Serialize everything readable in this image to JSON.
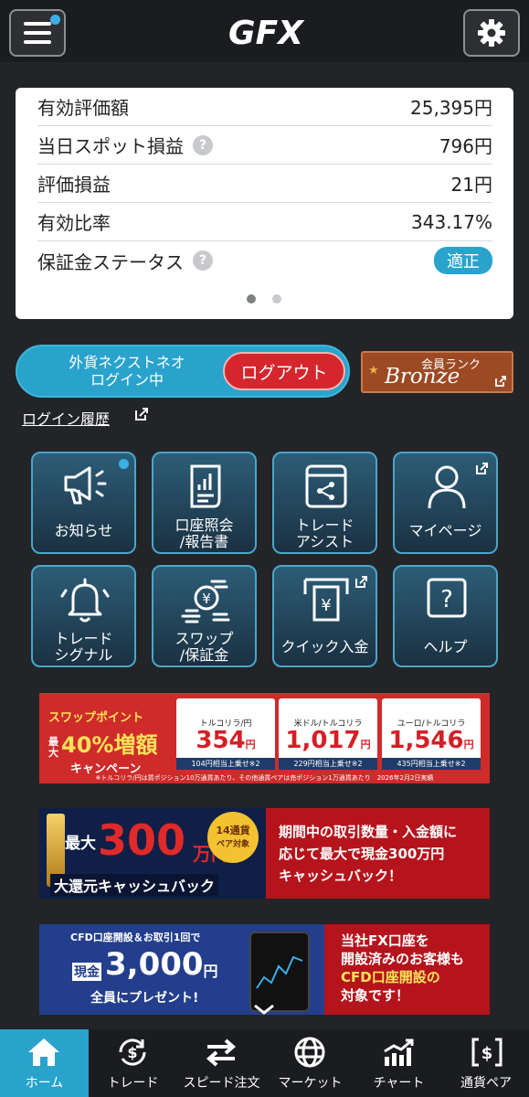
{
  "header": {
    "logo": "GFX",
    "menu_icon": "menu-icon",
    "settings_icon": "gear-icon"
  },
  "summary": {
    "rows": [
      {
        "label": "有効評価額",
        "value": "25,395円",
        "help": false
      },
      {
        "label": "当日スポット損益",
        "value": "796円",
        "help": true
      },
      {
        "label": "評価損益",
        "value": "21円",
        "help": false
      },
      {
        "label": "有効比率",
        "value": "343.17%",
        "help": false
      },
      {
        "label": "保証金ステータス",
        "value": "適正",
        "help": true
      }
    ],
    "help_mark": "?",
    "page": 1,
    "pages": 2
  },
  "login": {
    "status_line1": "外貨ネクストネオ",
    "status_line2": "ログイン中",
    "logout_label": "ログアウト"
  },
  "rank": {
    "title": "会員ランク",
    "value": "Bronze"
  },
  "login_history": "ログイン履歴",
  "tiles": [
    {
      "name": "news",
      "l1": "お知らせ",
      "l2": ""
    },
    {
      "name": "account-report",
      "l1": "口座照会",
      "l2": "/報告書"
    },
    {
      "name": "trade-assist",
      "l1": "トレード",
      "l2": "アシスト"
    },
    {
      "name": "mypage",
      "l1": "マイページ",
      "l2": ""
    },
    {
      "name": "trade-signal",
      "l1": "トレード",
      "l2": "シグナル"
    },
    {
      "name": "swap-margin",
      "l1": "スワップ",
      "l2": "/保証金"
    },
    {
      "name": "quick-deposit",
      "l1": "クイック入金",
      "l2": ""
    },
    {
      "name": "help",
      "l1": "ヘルプ",
      "l2": ""
    }
  ],
  "help_tile_mark": "?",
  "banner1": {
    "head1": "スワップポイント",
    "head2": "最大",
    "head3": "40%増額",
    "head4": "キャンペーン",
    "unit": "円",
    "per": "相当",
    "ref": "※2",
    "boxes": [
      {
        "pair": "トルコリラ/円",
        "value": "354",
        "bonus": "104円相当上乗せ※2"
      },
      {
        "pair": "米ドル/トルコリラ",
        "value": "1,017",
        "bonus": "229円相当上乗せ※2"
      },
      {
        "pair": "ユーロ/トルコリラ",
        "value": "1,546",
        "bonus": "435円相当上乗せ※2"
      }
    ],
    "note": "※トルコリラ/円は買ポジション10万通貨あたり、その他通貨ペアは売ポジション1万通貨あたり　2026年2月2日実績"
  },
  "banner2": {
    "big1": "最大",
    "big2": "300",
    "big3": "万円",
    "badge1": "14通貨",
    "badge2": "ペア対象",
    "line": "大還元キャッシュバック",
    "right1": "期間中の取引数量・入金額に",
    "right2": "応じて最大で現金300万円",
    "right3": "キャッシュバック！"
  },
  "banner3": {
    "top": "CFD口座開設＆お取引1回で",
    "big1": "現金",
    "big2": "3,000",
    "big3": "円",
    "sub": "全員にプレゼント!",
    "right1": "当社FX口座を",
    "right2": "開設済みのお客様も",
    "right3": "CFD口座開設の",
    "right4": "対象です！"
  },
  "tabs": [
    {
      "name": "home",
      "label": "ホーム"
    },
    {
      "name": "trade",
      "label": "トレード"
    },
    {
      "name": "speed-order",
      "label": "スピード注文"
    },
    {
      "name": "market",
      "label": "マーケット"
    },
    {
      "name": "chart",
      "label": "チャート"
    },
    {
      "name": "currency-pair",
      "label": "通貨ペア"
    }
  ],
  "colors": {
    "accent": "#2aa3cc",
    "danger": "#d5262e",
    "bronze": "#9c4a24"
  }
}
